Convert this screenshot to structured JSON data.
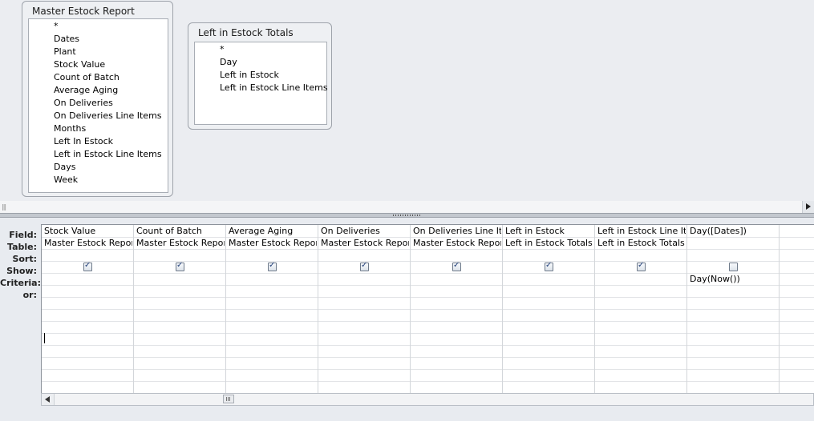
{
  "tables": [
    {
      "title": "Master Estock Report",
      "fields": [
        "*",
        "Dates",
        "Plant",
        "Stock Value",
        "Count of Batch",
        "Average Aging",
        "On Deliveries",
        "On Deliveries Line Items",
        "Months",
        "Left In Estock",
        "Left in Estock Line Items",
        "Days",
        "Week"
      ]
    },
    {
      "title": "Left in Estock Totals",
      "fields": [
        "*",
        "Day",
        "Left in Estock",
        "Left in Estock Line Items"
      ]
    }
  ],
  "grid": {
    "row_labels": [
      "Field:",
      "Table:",
      "Sort:",
      "Show:",
      "Criteria:",
      "or:"
    ],
    "columns": [
      {
        "field": "Stock Value",
        "table": "Master Estock Report",
        "sort": "",
        "show": true,
        "criteria": "",
        "or": ""
      },
      {
        "field": "Count of Batch",
        "table": "Master Estock Report",
        "sort": "",
        "show": true,
        "criteria": "",
        "or": ""
      },
      {
        "field": "Average Aging",
        "table": "Master Estock Report",
        "sort": "",
        "show": true,
        "criteria": "",
        "or": ""
      },
      {
        "field": "On Deliveries",
        "table": "Master Estock Report",
        "sort": "",
        "show": true,
        "criteria": "",
        "or": ""
      },
      {
        "field": "On Deliveries Line Iter",
        "table": "Master Estock Report",
        "sort": "",
        "show": true,
        "criteria": "",
        "or": ""
      },
      {
        "field": "Left in Estock",
        "table": "Left in Estock Totals",
        "sort": "",
        "show": true,
        "criteria": "",
        "or": ""
      },
      {
        "field": "Left in Estock Line Iter",
        "table": "Left in Estock Totals",
        "sort": "",
        "show": true,
        "criteria": "",
        "or": ""
      },
      {
        "field": "Day([Dates])",
        "table": "",
        "sort": "",
        "show": false,
        "criteria": "Day(Now())",
        "or": ""
      },
      {
        "field": "",
        "table": "",
        "sort": "",
        "show": null,
        "criteria": "",
        "or": ""
      }
    ]
  },
  "colors": {
    "checkbox_check": "#1f3d78",
    "grid_border": "#8c929b"
  }
}
